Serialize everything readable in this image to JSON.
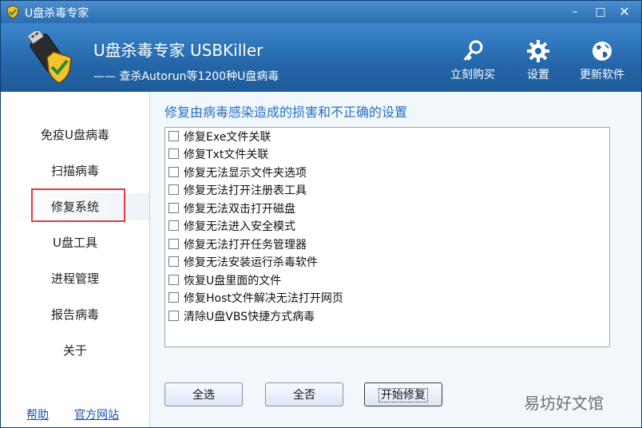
{
  "window": {
    "title": "U盘杀毒专家",
    "min": "–",
    "max": "□",
    "close": "✕"
  },
  "header": {
    "app_name": "U盘杀毒专家  USBKiller",
    "tagline": "—— 查杀Autorun等1200种U盘病毒",
    "buttons": [
      {
        "label": "立刻购买",
        "icon": "key-icon"
      },
      {
        "label": "设置",
        "icon": "gear-icon"
      },
      {
        "label": "更新软件",
        "icon": "globe-icon"
      }
    ]
  },
  "sidebar": {
    "items": [
      {
        "label": "免疫U盘病毒"
      },
      {
        "label": "扫描病毒"
      },
      {
        "label": "修复系统"
      },
      {
        "label": "U盘工具"
      },
      {
        "label": "进程管理"
      },
      {
        "label": "报告病毒"
      },
      {
        "label": "关于"
      }
    ],
    "active_index": 2,
    "footer": {
      "help": "帮助",
      "site": "官方网站"
    }
  },
  "main": {
    "title": "修复由病毒感染造成的损害和不正确的设置",
    "options": [
      {
        "label": "修复Exe文件关联",
        "checked": false
      },
      {
        "label": "修复Txt文件关联",
        "checked": false
      },
      {
        "label": "修复无法显示文件夹选项",
        "checked": false
      },
      {
        "label": "修复无法打开注册表工具",
        "checked": false
      },
      {
        "label": "修复无法双击打开磁盘",
        "checked": false
      },
      {
        "label": "修复无法进入安全模式",
        "checked": false
      },
      {
        "label": "修复无法打开任务管理器",
        "checked": false
      },
      {
        "label": "修复无法安装运行杀毒软件",
        "checked": false
      },
      {
        "label": "恢复U盘里面的文件",
        "checked": false
      },
      {
        "label": "修复Host文件解决无法打开网页",
        "checked": false
      },
      {
        "label": "清除U盘VBS快捷方式病毒",
        "checked": false
      }
    ],
    "buttons": {
      "select_all": "全选",
      "select_none": "全否",
      "start": "开始修复"
    }
  },
  "watermark": "易坊好文馆",
  "colors": {
    "title_bar": "#2a6db0",
    "header": "#2466a9",
    "title_text": "#2a6fc0",
    "highlight": "#e23b3b",
    "link": "#1a4fb0"
  }
}
